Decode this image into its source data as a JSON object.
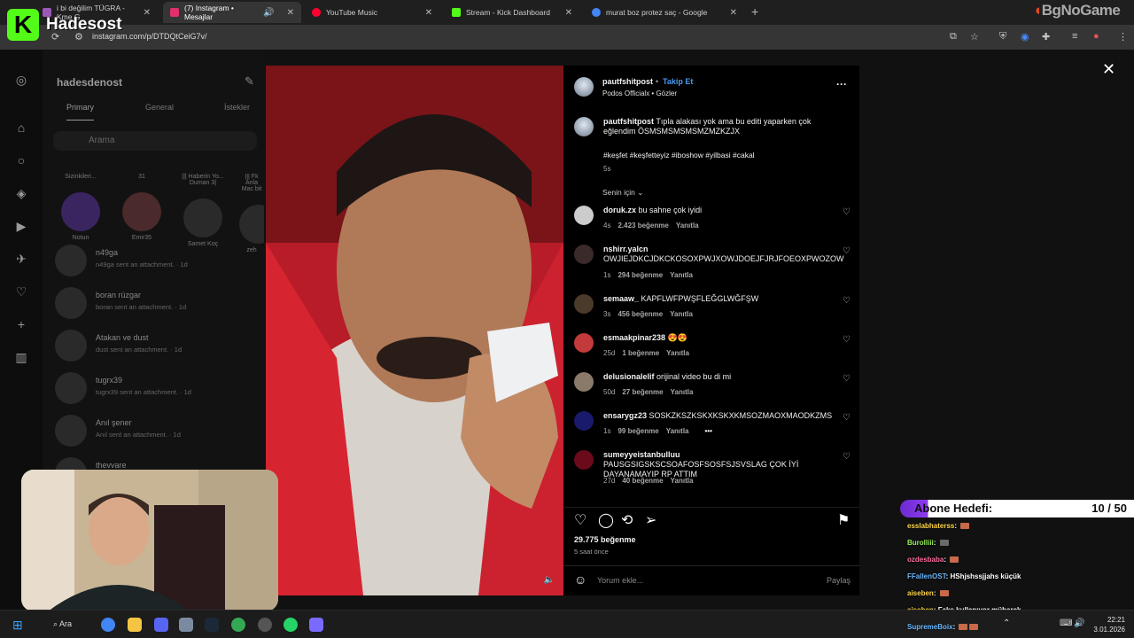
{
  "overlay": {
    "channel_name": "Hadesost",
    "logo_letter": "K",
    "watermark": "BgNoGame"
  },
  "browser": {
    "tabs": [
      {
        "label": "i bi değilim TÜGRA - Kme G",
        "active": false,
        "color": "#9b59b6"
      },
      {
        "label": "(7) Instagram • Mesajlar",
        "active": true,
        "color": "#e1306c"
      },
      {
        "label": "YouTube Music",
        "active": false,
        "color": "#ff0033"
      },
      {
        "label": "Stream - Kick Dashboard",
        "active": false,
        "color": "#53fc18"
      },
      {
        "label": "murat boz protez saç - Google",
        "active": false,
        "color": "#4285f4"
      }
    ],
    "new_tab": "+",
    "url": "instagram.com/p/DTDQtCeiG7v/"
  },
  "instagram": {
    "username": "hadesdenost",
    "dm_tabs": [
      "Primary",
      "General",
      "İstekler"
    ],
    "search_placeholder": "Arama",
    "notes": [
      {
        "label": "Notun",
        "caption": "Sizinkileri..."
      },
      {
        "label": "Emir35",
        "caption": "31"
      },
      {
        "label": "Samet Koç",
        "caption": "||| Haberin Yo... Duman 3|"
      },
      {
        "label": "zeh",
        "caption": "||| Fk Anla Mac bit"
      }
    ],
    "conversations": [
      {
        "name": "n49ga",
        "sub": "n49ga sent an attachment. · 1d"
      },
      {
        "name": "boran rüzgar",
        "sub": "boran sent an attachment. · 1d"
      },
      {
        "name": "Atakan ve dust",
        "sub": "dust sent an attachment. · 1d"
      },
      {
        "name": "tugrx39",
        "sub": "tugrx39 sent an attachment. · 1d"
      },
      {
        "name": "Anıl şener",
        "sub": "Anıl sent an attachment. · 1d"
      },
      {
        "name": "thevvare",
        "sub": ""
      }
    ]
  },
  "post": {
    "author": "pautfshitpost",
    "follow_label": "Takip Et",
    "subtitle": "Podos Officialx • Gözler",
    "more_icon": "more-icon",
    "caption_user": "pautfshitpost",
    "caption_text": "Tıpla alakası yok ama bu editi yaparken çok eğlendim ÖSMSMSMSMSMZMZKZJX",
    "hashtags": "#keşfet #keşfetteyiz #iboshow #yilbasi #cakal",
    "caption_time": "5s",
    "sort_label": "Senin için",
    "reply_label": "Yanıtla",
    "comments": [
      {
        "user": "doruk.zx",
        "text": "bu sahne çok iyidi",
        "time": "4s",
        "likes": "2.423 beğenme",
        "avatar": "#bbbbbb"
      },
      {
        "user": "nshirr.yalcn",
        "text": "OWJIEJDKCJDKCKOSOXPWJXOWJDOEJFJRJFOEOXPWOZOW",
        "time": "1s",
        "likes": "294 beğenme",
        "avatar": "#3a2a2a"
      },
      {
        "user": "semaaw_",
        "text": "KAPFLWFPWŞFLEĞGLWĞFŞW",
        "time": "3s",
        "likes": "456 beğenme",
        "avatar": "#4a3a2a"
      },
      {
        "user": "esmaakpinar238",
        "text": "😍😍",
        "time": "25d",
        "likes": "1 beğenme",
        "avatar": "#c23a3a"
      },
      {
        "user": "delusionalelif",
        "text": "orijinal video bu di mi",
        "time": "50d",
        "likes": "27 beğenme",
        "avatar": "#8a7a6a"
      },
      {
        "user": "ensarygz23",
        "text": "SOSKZKSZKSKXKSKXKMSOZMAOXMAODKZMS",
        "time": "1s",
        "likes": "99 beğenme",
        "avatar": "#1a1a6a",
        "extra": "•••"
      },
      {
        "user": "sumeyyeistanbulluu",
        "text": "PAUSGSIGSKSCSOAFOSFSOSFSJSVSLAG ÇOK İYİ DAYANAMAYIP RP ATTIM",
        "time": "27d",
        "likes": "40 beğenme",
        "avatar": "#6a0a1a"
      }
    ],
    "total_likes": "29.775 beğenme",
    "posted_ago": "5 saat önce",
    "comment_placeholder": "Yorum ekle...",
    "share_label": "Paylaş"
  },
  "stream": {
    "goal_label": "Abone Hedefi:",
    "goal_count": "10 / 50",
    "goal_progress": 0.2,
    "chat": [
      {
        "user": "esslabhaterss",
        "msg": ""
      },
      {
        "user": "Burolliii",
        "msg": ""
      },
      {
        "user": "ozdesbaba",
        "msg": ""
      },
      {
        "user": "FFallenOST",
        "msg": "HShjshssjjahs küçük"
      },
      {
        "user": "aiseben",
        "msg": ""
      },
      {
        "user": "aiseben",
        "msg": "Faks kullanıyor mübarek"
      },
      {
        "user": "SupremeBoix",
        "msg": ""
      }
    ]
  },
  "taskbar": {
    "search_label": "Ara",
    "time": "22:21",
    "date": "3.01.2026"
  }
}
